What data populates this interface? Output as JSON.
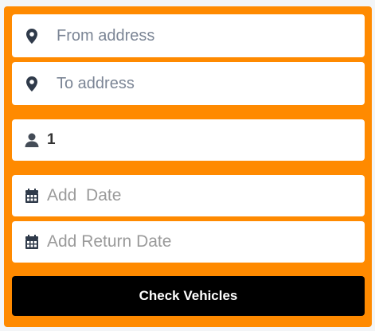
{
  "form": {
    "from_placeholder": "From address",
    "from_value": "",
    "to_placeholder": "To address",
    "to_value": "",
    "passengers_value": "1",
    "date_placeholder": "Add  Date",
    "date_value": "",
    "return_date_placeholder": "Add Return Date",
    "return_date_value": "",
    "submit_label": "Check Vehicles"
  },
  "icons": {
    "from": "map-marker-icon",
    "to": "map-marker-icon",
    "passengers": "user-icon",
    "date": "calendar-icon",
    "return_date": "calendar-icon"
  },
  "colors": {
    "panel": "#ff8a00",
    "field_bg": "#ffffff",
    "icon": "#2f3a4a",
    "button_bg": "#000000",
    "button_text": "#ffffff"
  }
}
